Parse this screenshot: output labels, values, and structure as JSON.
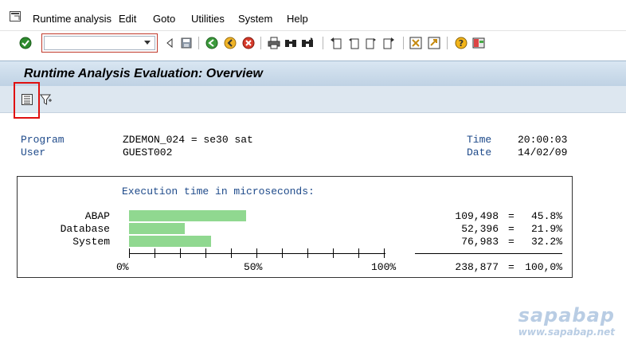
{
  "menu": {
    "items": [
      {
        "label": "Runtime analysis"
      },
      {
        "label": "Edit"
      },
      {
        "label": "Goto"
      },
      {
        "label": "Utilities"
      },
      {
        "label": "System"
      },
      {
        "label": "Help"
      }
    ]
  },
  "toolbar": {
    "command_value": "",
    "icons": [
      "enter-icon",
      "back-icon",
      "exit-icon",
      "cancel-icon",
      "print-icon",
      "find-icon",
      "find-next-icon",
      "first-page-icon",
      "previous-page-icon",
      "next-page-icon",
      "last-page-icon",
      "create-session-icon",
      "shortcut-icon",
      "help-icon",
      "layout-icon"
    ]
  },
  "page": {
    "title": "Runtime Analysis Evaluation: Overview"
  },
  "header": {
    "program_label": "Program",
    "program_value": "ZDEMON_024 = se30 sat",
    "user_label": "User",
    "user_value": "GUEST002",
    "time_label": "Time",
    "time_value": "20:00:03",
    "date_label": "Date",
    "date_value": "14/02/09"
  },
  "chart": {
    "heading": "Execution time in microseconds:",
    "rows": [
      {
        "label": "ABAP",
        "value": "109,498",
        "eq": "=",
        "pct": "45.8%",
        "fraction": 0.458
      },
      {
        "label": "Database",
        "value": "52,396",
        "eq": "=",
        "pct": "21.9%",
        "fraction": 0.219
      },
      {
        "label": "System",
        "value": "76,983",
        "eq": "=",
        "pct": "32.2%",
        "fraction": 0.322
      }
    ],
    "axis": {
      "min_label": "0%",
      "mid_label": "50%",
      "max_label": "100%"
    },
    "total": {
      "value": "238,877",
      "eq": "=",
      "pct": "100,0%"
    }
  },
  "watermark": {
    "brand": "sapabap",
    "url": "www.sapabap.net"
  }
}
